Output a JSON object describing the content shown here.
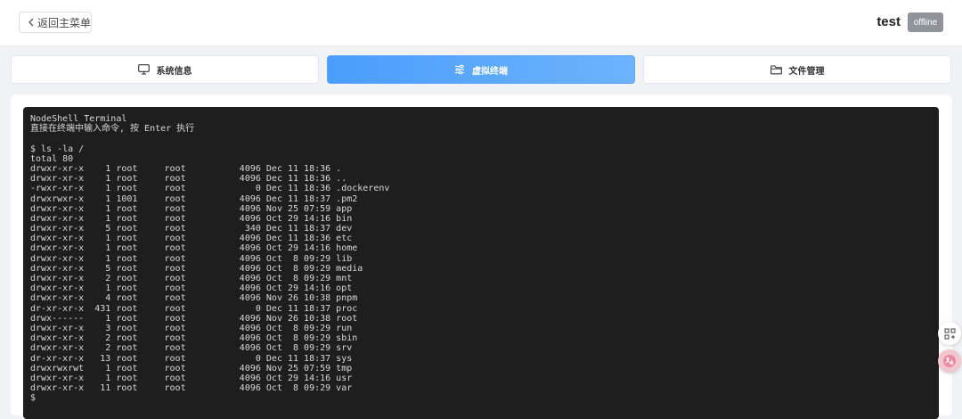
{
  "header": {
    "back_label": "返回主菜单",
    "host_name": "test",
    "status": "offline"
  },
  "tabs": [
    {
      "label": "系统信息",
      "icon": "monitor-icon",
      "active": false
    },
    {
      "label": "虚拟终端",
      "icon": "sliders-icon",
      "active": true
    },
    {
      "label": "文件管理",
      "icon": "folder-icon",
      "active": false
    }
  ],
  "terminal": {
    "lines": [
      "NodeShell Terminal",
      "直接在终端中输入命令, 按 Enter 执行",
      "",
      "$ ls -la /",
      "total 80",
      "drwxr-xr-x    1 root     root          4096 Dec 11 18:36 .",
      "drwxr-xr-x    1 root     root          4096 Dec 11 18:36 ..",
      "-rwxr-xr-x    1 root     root             0 Dec 11 18:36 .dockerenv",
      "drwxrwxr-x    1 1001     root          4096 Dec 11 18:37 .pm2",
      "drwxr-xr-x    1 root     root          4096 Nov 25 07:59 app",
      "drwxr-xr-x    1 root     root          4096 Oct 29 14:16 bin",
      "drwxr-xr-x    5 root     root           340 Dec 11 18:37 dev",
      "drwxr-xr-x    1 root     root          4096 Dec 11 18:36 etc",
      "drwxr-xr-x    1 root     root          4096 Oct 29 14:16 home",
      "drwxr-xr-x    1 root     root          4096 Oct  8 09:29 lib",
      "drwxr-xr-x    5 root     root          4096 Oct  8 09:29 media",
      "drwxr-xr-x    2 root     root          4096 Oct  8 09:29 mnt",
      "drwxr-xr-x    1 root     root          4096 Oct 29 14:16 opt",
      "drwxr-xr-x    4 root     root          4096 Nov 26 10:38 pnpm",
      "dr-xr-xr-x  431 root     root             0 Dec 11 18:37 proc",
      "drwx------    1 root     root          4096 Nov 26 10:38 root",
      "drwxr-xr-x    3 root     root          4096 Oct  8 09:29 run",
      "drwxr-xr-x    2 root     root          4096 Oct  8 09:29 sbin",
      "drwxr-xr-x    2 root     root          4096 Oct  8 09:29 srv",
      "dr-xr-xr-x   13 root     root             0 Dec 11 18:37 sys",
      "drwxrwxrwt    1 root     root          4096 Nov 25 07:59 tmp",
      "drwxr-xr-x    1 root     root          4096 Oct 29 14:16 usr",
      "drwxr-xr-x   11 root     root          4096 Oct  8 09:29 var",
      "$"
    ]
  },
  "floating_buttons": [
    {
      "icon": "qr-grid-icon"
    },
    {
      "icon": "translate-icon"
    }
  ],
  "colors": {
    "active_tab": "#4a9dfb",
    "terminal_bg": "#1e1e1e",
    "status_badge": "#909399"
  }
}
